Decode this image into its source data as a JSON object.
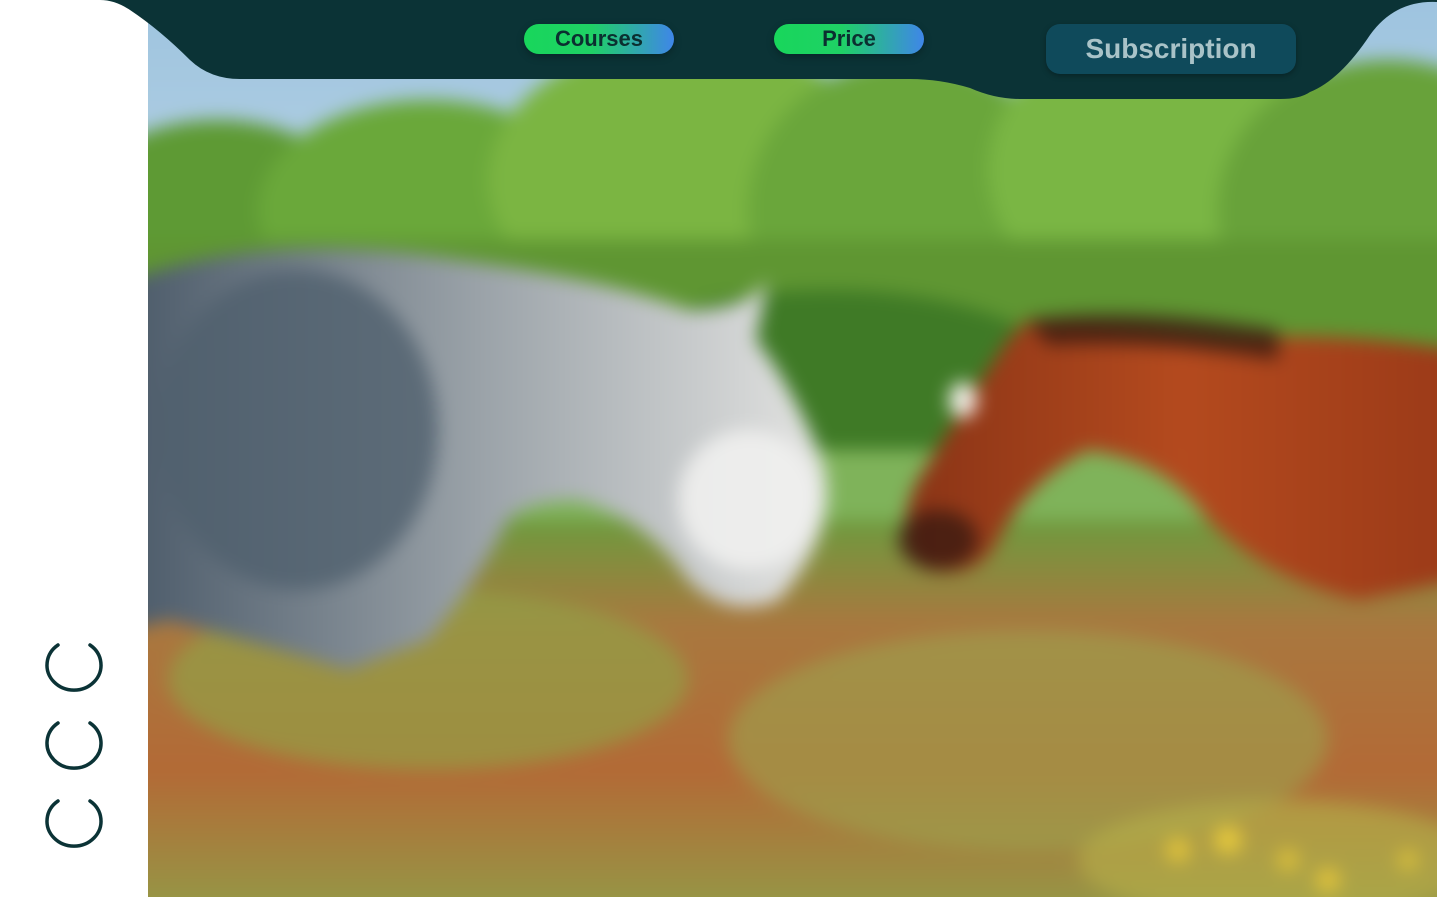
{
  "nav": {
    "items": [
      {
        "label": "Courses"
      },
      {
        "label": "Price"
      }
    ],
    "subscription_label": "Subscription"
  },
  "hero": {
    "image_icon": "horses-in-meadow-photo"
  },
  "side_indicators": {
    "count": 3,
    "icon": "spinner-icon"
  },
  "colors": {
    "topbar": "#0b3336",
    "pill_gradient_start": "#18d65b",
    "pill_gradient_end": "#3f86e8",
    "subscription_bg": "#0f4a5b",
    "subscription_text": "#a9c3c8",
    "spinner": "#0b3336"
  }
}
